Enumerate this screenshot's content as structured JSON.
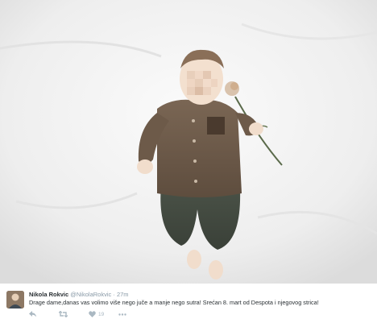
{
  "tweet": {
    "author": {
      "display_name": "Nikola Rokvic",
      "handle": "@NikolaRokvic",
      "separator": "·",
      "timestamp": "27m",
      "avatar_icon": "avatar-photo"
    },
    "text": "Drage dame,danas vas volimo više nego juče a manje nego sutra! Srećan 8. mart od Despota i njegovog strica!",
    "actions": {
      "reply_icon": "reply-icon",
      "retweet_icon": "retweet-icon",
      "like_icon": "heart-icon",
      "like_count": "19",
      "more_icon": "more-icon"
    }
  },
  "colors": {
    "name": "#292f33",
    "meta": "#8899a6",
    "action": "#aab8c2"
  }
}
